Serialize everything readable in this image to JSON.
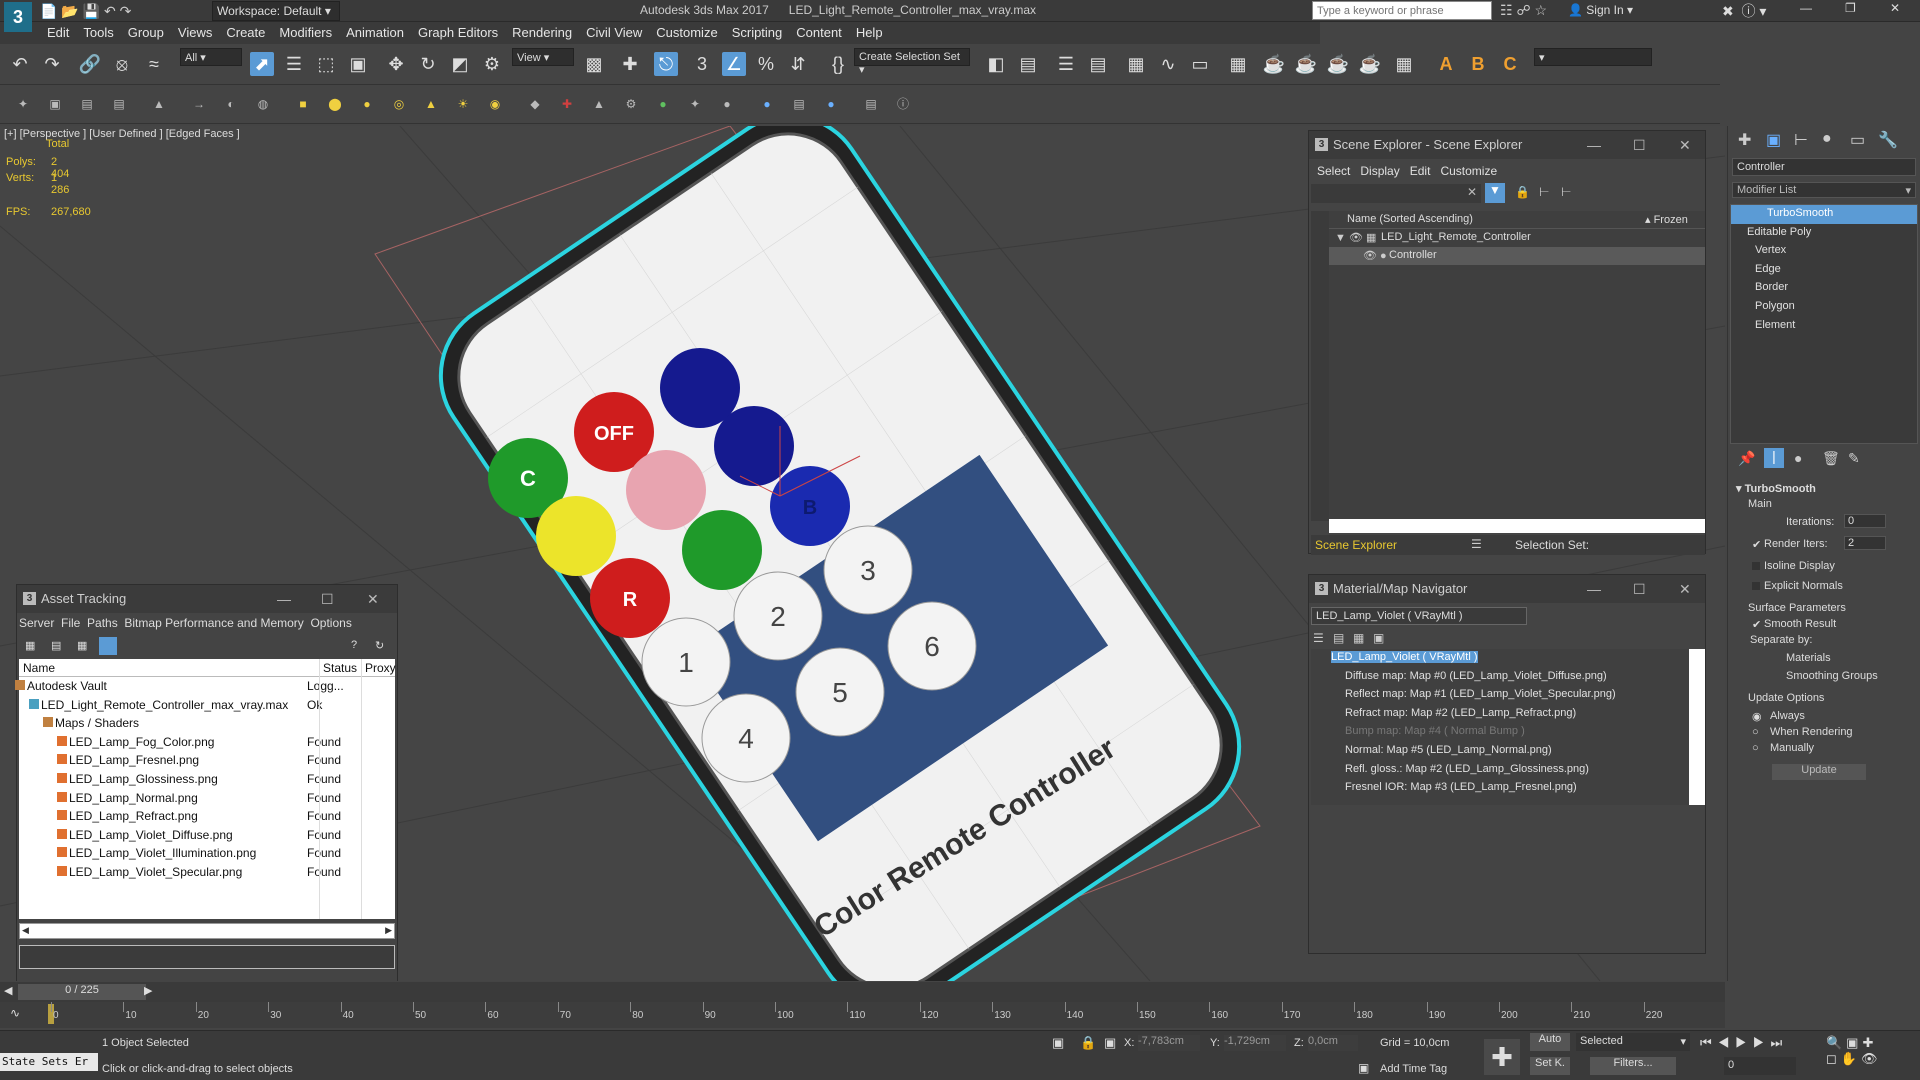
{
  "title": {
    "product": "Autodesk 3ds Max 2017",
    "file": "LED_Light_Remote_Controller_max_vray.max",
    "workspace": "Workspace: Default",
    "search_placeholder": "Type a keyword or phrase",
    "sign_in": "Sign In"
  },
  "menu": [
    "Edit",
    "Tools",
    "Group",
    "Views",
    "Create",
    "Modifiers",
    "Animation",
    "Graph Editors",
    "Rendering",
    "Civil View",
    "Customize",
    "Scripting",
    "Content",
    "Help"
  ],
  "toolbar": {
    "filter": "All",
    "view": "View",
    "selection_set": "Create Selection Set"
  },
  "viewport": {
    "label": "[+] [Perspective ] [User Defined ] [Edged Faces ]",
    "total": "Total",
    "polys_label": "Polys:",
    "polys": "2 404",
    "verts_label": "Verts:",
    "verts": "1 286",
    "fps_label": "FPS:",
    "fps": "267,680",
    "remote_text": "Color Remote Controller",
    "color_buttons": [
      "C",
      "OFF",
      "",
      "",
      "",
      "",
      "",
      "B",
      "",
      "R",
      ""
    ],
    "number_buttons": [
      "1",
      "2",
      "3",
      "4",
      "5",
      "6"
    ]
  },
  "scene_explorer": {
    "title": "Scene Explorer - Scene Explorer",
    "menu": [
      "Select",
      "Display",
      "Edit",
      "Customize"
    ],
    "col_name": "Name (Sorted Ascending)",
    "col_frozen": "▴ Frozen",
    "items": [
      "LED_Light_Remote_Controller",
      "Controller"
    ],
    "footer_left": "Scene Explorer",
    "footer_right": "Selection Set:"
  },
  "asset_tracking": {
    "title": "Asset Tracking",
    "menu": [
      "Server",
      "File",
      "Paths",
      "Bitmap Performance and Memory",
      "Options"
    ],
    "columns": [
      "Name",
      "Status",
      "Proxy"
    ],
    "rows": [
      {
        "name": "Autodesk Vault",
        "status": "Logg...",
        "indent": 0
      },
      {
        "name": "LED_Light_Remote_Controller_max_vray.max",
        "status": "Ok",
        "indent": 1
      },
      {
        "name": "Maps / Shaders",
        "status": "",
        "indent": 2
      },
      {
        "name": "LED_Lamp_Fog_Color.png",
        "status": "Found",
        "indent": 3
      },
      {
        "name": "LED_Lamp_Fresnel.png",
        "status": "Found",
        "indent": 3
      },
      {
        "name": "LED_Lamp_Glossiness.png",
        "status": "Found",
        "indent": 3
      },
      {
        "name": "LED_Lamp_Normal.png",
        "status": "Found",
        "indent": 3
      },
      {
        "name": "LED_Lamp_Refract.png",
        "status": "Found",
        "indent": 3
      },
      {
        "name": "LED_Lamp_Violet_Diffuse.png",
        "status": "Found",
        "indent": 3
      },
      {
        "name": "LED_Lamp_Violet_Illumination.png",
        "status": "Found",
        "indent": 3
      },
      {
        "name": "LED_Lamp_Violet_Specular.png",
        "status": "Found",
        "indent": 3
      }
    ]
  },
  "material_navigator": {
    "title": "Material/Map Navigator",
    "current": "LED_Lamp_Violet  ( VRayMtl )",
    "items": [
      {
        "label": "LED_Lamp_Violet  ( VRayMtl )",
        "selected": true,
        "dim": false
      },
      {
        "label": "Diffuse map: Map #0 (LED_Lamp_Violet_Diffuse.png)",
        "selected": false,
        "dim": false
      },
      {
        "label": "Reflect map: Map #1 (LED_Lamp_Violet_Specular.png)",
        "selected": false,
        "dim": false
      },
      {
        "label": "Refract map: Map #2 (LED_Lamp_Refract.png)",
        "selected": false,
        "dim": false
      },
      {
        "label": "Bump map: Map #4  ( Normal Bump )",
        "selected": false,
        "dim": true
      },
      {
        "label": "Normal: Map #5 (LED_Lamp_Normal.png)",
        "selected": false,
        "dim": false
      },
      {
        "label": "Refl. gloss.: Map #2 (LED_Lamp_Glossiness.png)",
        "selected": false,
        "dim": false
      },
      {
        "label": "Fresnel IOR: Map #3 (LED_Lamp_Fresnel.png)",
        "selected": false,
        "dim": false
      }
    ]
  },
  "command_panel": {
    "object_name": "Controller",
    "modifier_list": "Modifier List",
    "stack": [
      {
        "label": "TurboSmooth",
        "level": 0,
        "selected": true
      },
      {
        "label": "Editable Poly",
        "level": 0,
        "selected": false
      },
      {
        "label": "Vertex",
        "level": 1,
        "selected": false
      },
      {
        "label": "Edge",
        "level": 1,
        "selected": false
      },
      {
        "label": "Border",
        "level": 1,
        "selected": false
      },
      {
        "label": "Polygon",
        "level": 1,
        "selected": false
      },
      {
        "label": "Element",
        "level": 1,
        "selected": false
      }
    ],
    "rollout": "TurboSmooth",
    "main": "Main",
    "iterations_label": "Iterations:",
    "iterations": "0",
    "render_iters_label": "Render Iters:",
    "render_iters": "2",
    "isoline": "Isoline Display",
    "explicit_normals": "Explicit Normals",
    "surface_params": "Surface Parameters",
    "smooth_result": "Smooth Result",
    "separate_by": "Separate by:",
    "materials": "Materials",
    "smoothing_groups": "Smoothing Groups",
    "update_options": "Update Options",
    "always": "Always",
    "when_rendering": "When Rendering",
    "manually": "Manually",
    "update_btn": "Update"
  },
  "timeline": {
    "frame": "0 / 225",
    "ticks": [
      "0",
      "10",
      "20",
      "30",
      "40",
      "50",
      "60",
      "70",
      "80",
      "90",
      "100",
      "110",
      "120",
      "130",
      "140",
      "150",
      "160",
      "170",
      "180",
      "190",
      "200",
      "210",
      "220"
    ]
  },
  "status": {
    "state_sets": "State Sets Er",
    "selected": "1 Object Selected",
    "prompt": "Click or click-and-drag to select objects",
    "x_label": "X:",
    "x": "-7,783cm",
    "y_label": "Y:",
    "y": "-1,729cm",
    "z_label": "Z:",
    "z": "0,0cm",
    "grid": "Grid = 10,0cm",
    "add_time_tag": "Add Time Tag",
    "auto": "Auto",
    "selected_dd": "Selected",
    "set_k": "Set K.",
    "filters": "Filters...",
    "frame_field": "0"
  },
  "colors": {
    "accent": "#5b9bd5",
    "highlight": "#2bd4e0",
    "stat": "#e8c830"
  }
}
